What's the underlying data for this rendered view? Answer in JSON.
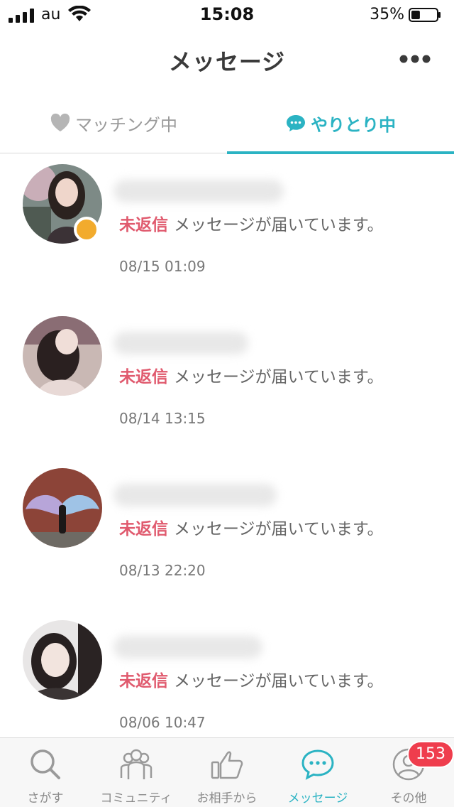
{
  "status_bar": {
    "carrier": "au",
    "time": "15:08",
    "battery_percent": "35%",
    "battery_level": 0.35
  },
  "header": {
    "title": "メッセージ",
    "more_icon": "more-horizontal-icon"
  },
  "tabs": [
    {
      "label": "マッチング中",
      "icon": "heart-icon",
      "active": false
    },
    {
      "label": "やりとり中",
      "icon": "chat-bubble-icon",
      "active": true
    }
  ],
  "conversations": [
    {
      "status": "未返信",
      "preview": "メッセージが届いています。",
      "time": "08/15 01:09",
      "online": true
    },
    {
      "status": "未返信",
      "preview": "メッセージが届いています。",
      "time": "08/14 13:15",
      "online": false
    },
    {
      "status": "未返信",
      "preview": "メッセージが届いています。",
      "time": "08/13 22:20",
      "online": false
    },
    {
      "status": "未返信",
      "preview": "メッセージが届いています。",
      "time": "08/06 10:47",
      "online": false
    }
  ],
  "tabbar": [
    {
      "label": "さがす",
      "icon": "search-icon",
      "active": false
    },
    {
      "label": "コミュニティ",
      "icon": "community-icon",
      "active": false
    },
    {
      "label": "お相手から",
      "icon": "thumbs-up-icon",
      "active": false
    },
    {
      "label": "メッセージ",
      "icon": "chat-bubble-icon",
      "active": true
    },
    {
      "label": "その他",
      "icon": "user-icon",
      "active": false,
      "badge": "153"
    }
  ],
  "colors": {
    "accent": "#2bb3c3",
    "unreplied": "#e05a6e",
    "online": "#f2ab2d",
    "badge": "#ef3d4d"
  }
}
